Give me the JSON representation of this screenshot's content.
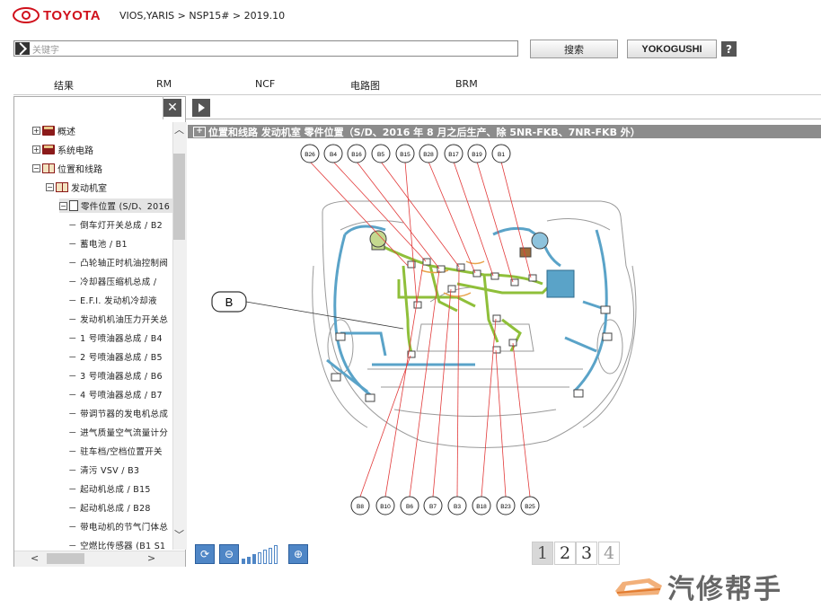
{
  "header": {
    "brand": "TOYOTA",
    "breadcrumb": "VIOS,YARIS > NSP15# > 2019.10",
    "search_placeholder": "关键字",
    "search_button": "搜索",
    "yokogushi_button": "YOKOGUSHI",
    "help_button": "?"
  },
  "tabs": [
    "结果",
    "RM",
    "NCF",
    "电路图",
    "BRM"
  ],
  "tree": {
    "clear_button": "✕",
    "items": [
      {
        "label": "概述",
        "level": 0,
        "expander": "+",
        "icon": "book"
      },
      {
        "label": "系统电路",
        "level": 0,
        "expander": "+",
        "icon": "book"
      },
      {
        "label": "位置和线路",
        "level": 0,
        "expander": "−",
        "icon": "open-book"
      },
      {
        "label": "发动机室",
        "level": 1,
        "expander": "−",
        "icon": "open-book"
      },
      {
        "label": "零件位置 (S/D、2016",
        "level": 2,
        "expander": "−",
        "icon": "doc",
        "selected": true
      },
      {
        "label": "－ 倒车灯开关总成 / B2",
        "level": 3
      },
      {
        "label": "－ 蓄电池 / B1",
        "level": 3
      },
      {
        "label": "－ 凸轮轴正时机油控制阀",
        "level": 3
      },
      {
        "label": "－ 冷却器压缩机总成 /",
        "level": 3
      },
      {
        "label": "－ E.F.I. 发动机冷却液",
        "level": 3
      },
      {
        "label": "－ 发动机机油压力开关总",
        "level": 3
      },
      {
        "label": "－ 1 号喷油器总成 / B4",
        "level": 3
      },
      {
        "label": "－ 2 号喷油器总成 / B5",
        "level": 3
      },
      {
        "label": "－ 3 号喷油器总成 / B6",
        "level": 3
      },
      {
        "label": "－ 4 号喷油器总成 / B7",
        "level": 3
      },
      {
        "label": "－ 带调节器的发电机总成",
        "level": 3
      },
      {
        "label": "－ 进气质量空气流量计分",
        "level": 3
      },
      {
        "label": "－ 驻车档/空档位置开关",
        "level": 3
      },
      {
        "label": "－ 清污 VSV / B3",
        "level": 3
      },
      {
        "label": "－ 起动机总成 / B15",
        "level": 3
      },
      {
        "label": "－ 起动机总成 / B28",
        "level": 3
      },
      {
        "label": "－ 带电动机的节气门体总",
        "level": 3
      },
      {
        "label": "－ 空燃比传感器 (B1 S1",
        "level": 3
      }
    ],
    "scroll_up": "︿",
    "scroll_down": "﹀",
    "scroll_left": "<",
    "scroll_right": ">"
  },
  "viewer": {
    "title_toggle": "+",
    "title": "位置和线路  发动机室  零件位置（S/D、2016 年 8 月之后生产、除 5NR-FKB、7NR-FKB 外）",
    "callout": "B",
    "top_connectors": [
      "B26",
      "B4",
      "B16",
      "B5",
      "B15",
      "B28",
      "B17",
      "B19",
      "B1"
    ],
    "bottom_connectors": [
      "B8",
      "B10",
      "B6",
      "B7",
      "B3",
      "B18",
      "B23",
      "B25"
    ],
    "zoom_level": 3,
    "zoom_levels_total": 7,
    "pages": [
      "1",
      "2",
      "3",
      "4"
    ],
    "current_page": "1"
  },
  "watermark": "汽修帮手",
  "colors": {
    "brand_red": "#d0101b",
    "wire_green": "#8fbf3a",
    "wire_blue": "#5aa3c8",
    "leader_red": "#e23a3a",
    "tool_blue": "#4f86c6"
  }
}
